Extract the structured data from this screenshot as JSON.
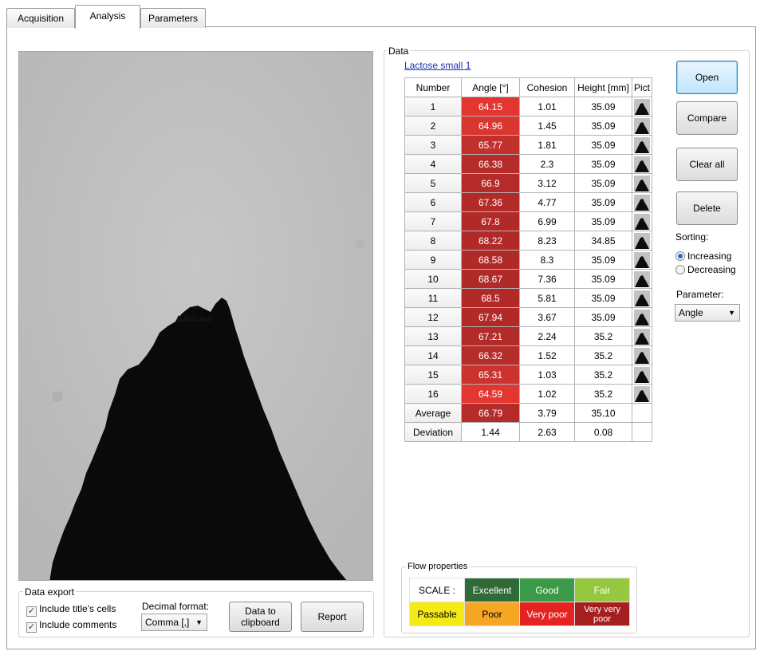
{
  "tabs": [
    {
      "label": "Acquisition",
      "active": false
    },
    {
      "label": "Analysis",
      "active": true
    },
    {
      "label": "Parameters",
      "active": false
    }
  ],
  "data_export": {
    "title": "Data export",
    "include_titles_label": "Include title's cells",
    "include_titles_checked": true,
    "include_comments_label": "Include comments",
    "include_comments_checked": true,
    "decimal_format_label": "Decimal format:",
    "decimal_format_value": "Comma [,]",
    "clipboard_button": "Data to clipboard",
    "report_button": "Report"
  },
  "data_group": {
    "title": "Data",
    "sample_link": "Lactose small 1",
    "columns": [
      "Number",
      "Angle [°]",
      "Cohesion",
      "Height [mm]",
      "Pict"
    ],
    "rows": [
      {
        "number": "1",
        "angle": "64.15",
        "cohesion": "1.01",
        "height": "35.09",
        "color": "#e43631"
      },
      {
        "number": "2",
        "angle": "64.96",
        "cohesion": "1.45",
        "height": "35.09",
        "color": "#d93630"
      },
      {
        "number": "3",
        "angle": "65.77",
        "cohesion": "1.81",
        "height": "35.09",
        "color": "#c2302c"
      },
      {
        "number": "4",
        "angle": "66.38",
        "cohesion": "2.3",
        "height": "35.09",
        "color": "#b52c2a"
      },
      {
        "number": "5",
        "angle": "66.9",
        "cohesion": "3.12",
        "height": "35.09",
        "color": "#b42b29"
      },
      {
        "number": "6",
        "angle": "67.36",
        "cohesion": "4.77",
        "height": "35.09",
        "color": "#b22b29"
      },
      {
        "number": "7",
        "angle": "67.8",
        "cohesion": "6.99",
        "height": "35.09",
        "color": "#b12a28"
      },
      {
        "number": "8",
        "angle": "68.22",
        "cohesion": "8.23",
        "height": "34.85",
        "color": "#b12a28"
      },
      {
        "number": "9",
        "angle": "68.58",
        "cohesion": "8.3",
        "height": "35.09",
        "color": "#b02a28"
      },
      {
        "number": "10",
        "angle": "68.67",
        "cohesion": "7.36",
        "height": "35.09",
        "color": "#b02a28"
      },
      {
        "number": "11",
        "angle": "68.5",
        "cohesion": "5.81",
        "height": "35.09",
        "color": "#b12a28"
      },
      {
        "number": "12",
        "angle": "67.94",
        "cohesion": "3.67",
        "height": "35.09",
        "color": "#b12a28"
      },
      {
        "number": "13",
        "angle": "67.21",
        "cohesion": "2.24",
        "height": "35.2",
        "color": "#b32b29"
      },
      {
        "number": "14",
        "angle": "66.32",
        "cohesion": "1.52",
        "height": "35.2",
        "color": "#b52c2a"
      },
      {
        "number": "15",
        "angle": "65.31",
        "cohesion": "1.03",
        "height": "35.2",
        "color": "#cc332e"
      },
      {
        "number": "16",
        "angle": "64.59",
        "cohesion": "1.02",
        "height": "35.2",
        "color": "#e43631"
      }
    ],
    "average": {
      "label": "Average",
      "angle": "66.79",
      "cohesion": "3.79",
      "height": "35.10",
      "color": "#b42b29"
    },
    "deviation": {
      "label": "Deviation",
      "angle": "1.44",
      "cohesion": "2.63",
      "height": "0.08"
    }
  },
  "side_buttons": {
    "open": "Open",
    "compare": "Compare",
    "clear_all": "Clear all",
    "delete": "Delete"
  },
  "sorting": {
    "label": "Sorting:",
    "increasing": "Increasing",
    "decreasing": "Decreasing",
    "selected": "increasing"
  },
  "parameter": {
    "label": "Parameter:",
    "value": "Angle"
  },
  "flow_properties": {
    "title": "Flow properties",
    "rows": [
      [
        {
          "label": "SCALE :",
          "bg": "#ffffff",
          "fg": "#000000"
        },
        {
          "label": "Excellent",
          "bg": "#2f6a37",
          "fg": "#ffffff"
        },
        {
          "label": "Good",
          "bg": "#3b9a47",
          "fg": "#ffffff"
        },
        {
          "label": "Fair",
          "bg": "#96c83f",
          "fg": "#ffffff"
        }
      ],
      [
        {
          "label": "Passable",
          "bg": "#f3ea16",
          "fg": "#000000"
        },
        {
          "label": "Poor",
          "bg": "#f6a623",
          "fg": "#000000"
        },
        {
          "label": "Very poor",
          "bg": "#e52421",
          "fg": "#ffffff"
        },
        {
          "label": "Very very poor",
          "bg": "#a51f1f",
          "fg": "#ffffff"
        }
      ]
    ]
  }
}
